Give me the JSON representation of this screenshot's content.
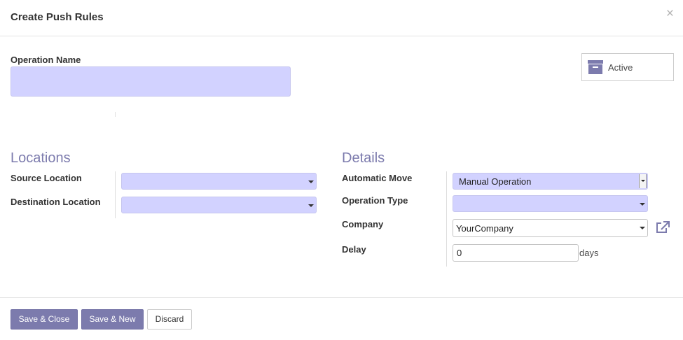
{
  "dialog": {
    "title": "Create Push Rules",
    "close_glyph": "×"
  },
  "form": {
    "operation_name_label": "Operation Name",
    "operation_name_value": "",
    "active_button_label": "Active"
  },
  "locations": {
    "heading": "Locations",
    "source_location_label": "Source Location",
    "source_location_value": "",
    "destination_location_label": "Destination Location",
    "destination_location_value": ""
  },
  "details": {
    "heading": "Details",
    "automatic_move_label": "Automatic Move",
    "automatic_move_value": "Manual Operation",
    "operation_type_label": "Operation Type",
    "operation_type_value": "",
    "company_label": "Company",
    "company_value": "YourCompany",
    "delay_label": "Delay",
    "delay_value": "0",
    "delay_unit": "days"
  },
  "footer": {
    "save_close_label": "Save & Close",
    "save_new_label": "Save & New",
    "discard_label": "Discard"
  },
  "colors": {
    "accent": "#7c7bad",
    "required_field": "#d2d2ff"
  },
  "icons": {
    "active": "archive-box-icon",
    "company_link": "external-link-icon",
    "close": "close-icon"
  }
}
